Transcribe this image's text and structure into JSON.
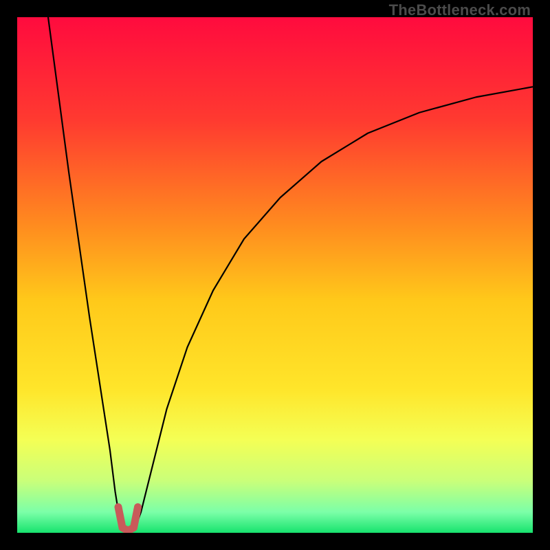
{
  "watermark": "TheBottleneck.com",
  "chart_data": {
    "type": "line",
    "title": "",
    "xlabel": "",
    "ylabel": "",
    "xlim": [
      0,
      100
    ],
    "ylim": [
      0,
      100
    ],
    "grid": false,
    "legend": false,
    "background_gradient": {
      "stops": [
        {
          "offset": 0.0,
          "color": "#ff0b3e"
        },
        {
          "offset": 0.2,
          "color": "#ff3a30"
        },
        {
          "offset": 0.4,
          "color": "#ff8a1f"
        },
        {
          "offset": 0.55,
          "color": "#ffc91a"
        },
        {
          "offset": 0.72,
          "color": "#ffe52a"
        },
        {
          "offset": 0.82,
          "color": "#f4ff55"
        },
        {
          "offset": 0.9,
          "color": "#c9ff7a"
        },
        {
          "offset": 0.96,
          "color": "#7bffa8"
        },
        {
          "offset": 1.0,
          "color": "#17e36e"
        }
      ]
    },
    "series": [
      {
        "name": "curve-left",
        "x": [
          6,
          8,
          10,
          12,
          14,
          16,
          18,
          19,
          19.8,
          20.3
        ],
        "y": [
          100,
          85,
          70,
          56,
          42,
          29,
          16,
          8,
          3,
          0.5
        ]
      },
      {
        "name": "curve-right",
        "x": [
          22.7,
          24,
          26,
          29,
          33,
          38,
          44,
          51,
          59,
          68,
          78,
          89,
          100
        ],
        "y": [
          0.5,
          4,
          12,
          24,
          36,
          47,
          57,
          65,
          72,
          77.5,
          81.5,
          84.5,
          86.5
        ]
      },
      {
        "name": "valley-marker",
        "stroke": "#c85a5a",
        "stroke_width": 11,
        "linecap": "round",
        "x": [
          19.6,
          20.4,
          21.5,
          22.6,
          23.4
        ],
        "y": [
          5.0,
          1.0,
          0.4,
          1.0,
          5.0
        ]
      }
    ]
  }
}
